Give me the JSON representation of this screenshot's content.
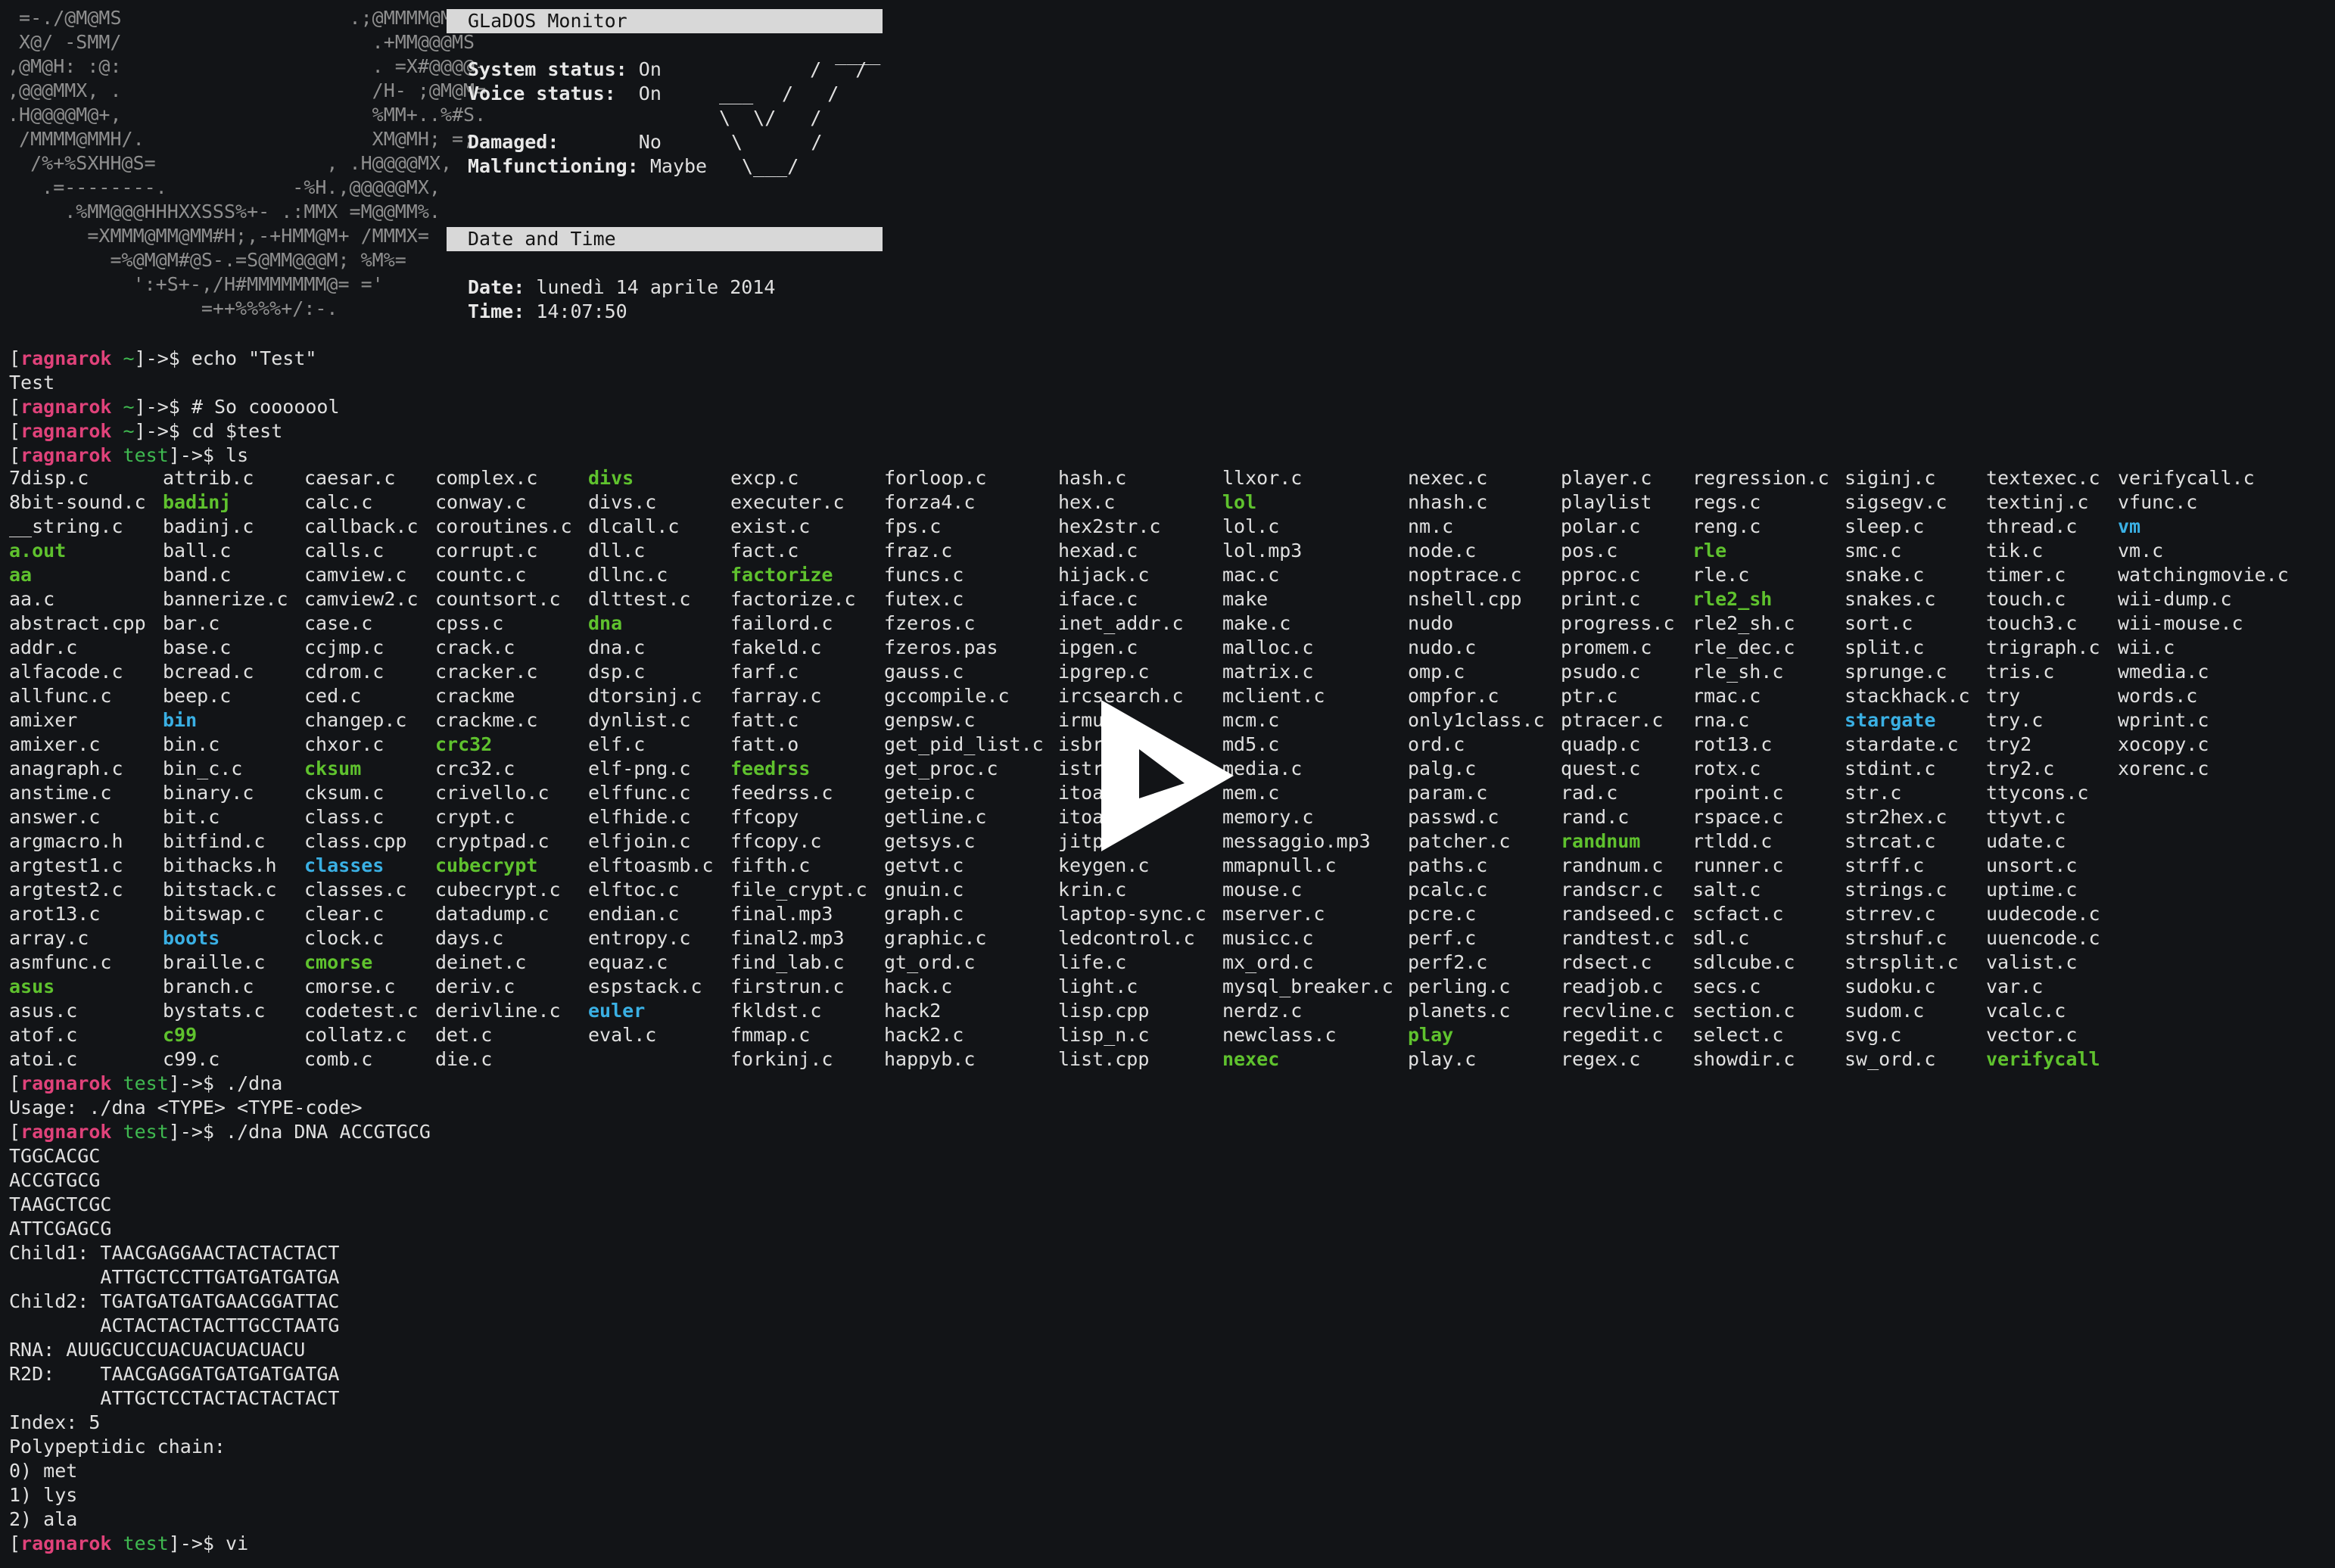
{
  "ascii_art": [
    " =-./@M@MS                    .;@MMMM@MM:",
    " X@/ -SMM/                      .+MM@@@MS",
    ",@M@H: :@:                      . =X#@@@@-",
    ",@@@MMX, .                      /H- ;@M@M=",
    ".H@@@@M@+,                      %MM+..%#S.",
    " /MMMM@MMH/.                    XM@MH; =;",
    "  /%+%SXHH@S=               , .H@@@@MX,",
    "   .=--------.           -%H.,@@@@@MX,",
    "     .%MM@@@HHHXXSSS%+- .:MMX =M@@MM%.",
    "       =XMMM@MM@MM#H;,-+HMM@M+ /MMMX=",
    "         =%@M@M#@S-.=S@MM@@@M; %M%=",
    "           ':+S+-,/H#MMMMMMM@= ='",
    "                 =++%%%%+/:-."
  ],
  "glados_panel": {
    "title": "GLaDOS Monitor",
    "system_status_label": "System status:",
    "system_status_value": "On",
    "voice_status_label": "Voice status:",
    "voice_status_value": "On",
    "damaged_label": "Damaged:",
    "damaged_value": "No",
    "malfunctioning_label": "Malfunctioning:",
    "malfunctioning_value": "Maybe",
    "logo_lines": [
      "   ____",
      "  /   /",
      " /   /",
      "/   /",
      "   /",
      "  /",
      "_/"
    ]
  },
  "datetime_panel": {
    "title": "Date and Time",
    "date_label": "Date:",
    "date_value": "lunedì 14 aprile 2014",
    "time_label": "Time:",
    "time_value": "14:07:50"
  },
  "prompt": {
    "user": "ragnarok",
    "open": "[",
    "close": "]->$ "
  },
  "session_top": [
    {
      "type": "prompt",
      "cwd": "~",
      "cmd": "echo \"Test\""
    },
    {
      "type": "out",
      "text": "Test"
    },
    {
      "type": "prompt",
      "cwd": "~",
      "cmd": "# So cooooool"
    },
    {
      "type": "prompt",
      "cwd": "~",
      "cmd": "cd $test"
    },
    {
      "type": "prompt",
      "cwd": "test",
      "cmd": "ls"
    }
  ],
  "ls_columns": [
    [
      "7disp.c",
      "8bit-sound.c",
      "__string.c",
      "a.out",
      "aa",
      "aa.c",
      "abstract.cpp",
      "addr.c",
      "alfacode.c",
      "allfunc.c",
      "amixer",
      "amixer.c",
      "anagraph.c",
      "anstime.c",
      "answer.c",
      "argmacro.h",
      "argtest1.c",
      "argtest2.c",
      "arot13.c",
      "array.c",
      "asmfunc.c",
      "asus",
      "asus.c",
      "atof.c",
      "atoi.c"
    ],
    [
      "attrib.c",
      "badinj",
      "badinj.c",
      "ball.c",
      "band.c",
      "bannerize.c",
      "bar.c",
      "base.c",
      "bcread.c",
      "beep.c",
      "bin",
      "bin.c",
      "bin_c.c",
      "binary.c",
      "bit.c",
      "bitfind.c",
      "bithacks.h",
      "bitstack.c",
      "bitswap.c",
      "boots",
      "braille.c",
      "branch.c",
      "bystats.c",
      "c99",
      "c99.c"
    ],
    [
      "caesar.c",
      "calc.c",
      "callback.c",
      "calls.c",
      "camview.c",
      "camview2.c",
      "case.c",
      "ccjmp.c",
      "cdrom.c",
      "ced.c",
      "changep.c",
      "chxor.c",
      "cksum",
      "cksum.c",
      "class.c",
      "class.cpp",
      "classes",
      "classes.c",
      "clear.c",
      "clock.c",
      "cmorse",
      "cmorse.c",
      "codetest.c",
      "collatz.c",
      "comb.c"
    ],
    [
      "complex.c",
      "conway.c",
      "coroutines.c",
      "corrupt.c",
      "countc.c",
      "countsort.c",
      "cpss.c",
      "crack.c",
      "cracker.c",
      "crackme",
      "crackme.c",
      "crc32",
      "crc32.c",
      "crivello.c",
      "crypt.c",
      "cryptpad.c",
      "cubecrypt",
      "cubecrypt.c",
      "datadump.c",
      "days.c",
      "deinet.c",
      "deriv.c",
      "derivline.c",
      "det.c",
      "die.c"
    ],
    [
      "divs",
      "divs.c",
      "dlcall.c",
      "dll.c",
      "dllnc.c",
      "dlttest.c",
      "dna",
      "dna.c",
      "dsp.c",
      "dtorsinj.c",
      "dynlist.c",
      "elf.c",
      "elf-png.c",
      "elffunc.c",
      "elfhide.c",
      "elfjoin.c",
      "elftoasmb.c",
      "elftoc.c",
      "endian.c",
      "entropy.c",
      "equaz.c",
      "espstack.c",
      "euler",
      "eval.c"
    ],
    [
      "excp.c",
      "executer.c",
      "exist.c",
      "fact.c",
      "factorize",
      "factorize.c",
      "failord.c",
      "fakeld.c",
      "farf.c",
      "farray.c",
      "fatt.c",
      "fatt.o",
      "feedrss",
      "feedrss.c",
      "ffcopy",
      "ffcopy.c",
      "fifth.c",
      "file_crypt.c",
      "final.mp3",
      "final2.mp3",
      "find_lab.c",
      "firstrun.c",
      "fkldst.c",
      "fmmap.c",
      "forkinj.c"
    ],
    [
      "forloop.c",
      "forza4.c",
      "fps.c",
      "fraz.c",
      "funcs.c",
      "futex.c",
      "fzeros.c",
      "fzeros.pas",
      "gauss.c",
      "gccompile.c",
      "genpsw.c",
      "get_pid_list.c",
      "get_proc.c",
      "geteip.c",
      "getline.c",
      "getsys.c",
      "getvt.c",
      "gnuin.c",
      "graph.c",
      "graphic.c",
      "gt_ord.c",
      "hack.c",
      "hack2",
      "hack2.c",
      "happyb.c"
    ],
    [
      "hash.c",
      "hex.c",
      "hex2str.c",
      "hexad.c",
      "hijack.c",
      "iface.c",
      "inet_addr.c",
      "ipgen.c",
      "ipgrep.c",
      "ircsearch.c",
      "irmu",
      "isbr",
      "istr",
      "itoa",
      "itoa",
      "jitp",
      "keygen.c",
      "krin.c",
      "laptop-sync.c",
      "ledcontrol.c",
      "life.c",
      "light.c",
      "lisp.cpp",
      "lisp_n.c",
      "list.cpp"
    ],
    [
      "llxor.c",
      "lol",
      "lol.c",
      "lol.mp3",
      "mac.c",
      "make",
      "make.c",
      "malloc.c",
      "matrix.c",
      "mclient.c",
      "mcm.c",
      "md5.c",
      "media.c",
      "mem.c",
      "memory.c",
      "messaggio.mp3",
      "mmapnull.c",
      "mouse.c",
      "mserver.c",
      "musicc.c",
      "mx_ord.c",
      "mysql_breaker.c",
      "nerdz.c",
      "newclass.c",
      "nexec"
    ],
    [
      "nexec.c",
      "nhash.c",
      "nm.c",
      "node.c",
      "noptrace.c",
      "nshell.cpp",
      "nudo",
      "nudo.c",
      "omp.c",
      "ompfor.c",
      "only1class.c",
      "ord.c",
      "palg.c",
      "param.c",
      "passwd.c",
      "patcher.c",
      "paths.c",
      "pcalc.c",
      "pcre.c",
      "perf.c",
      "perf2.c",
      "perling.c",
      "planets.c",
      "play",
      "play.c"
    ],
    [
      "player.c",
      "playlist",
      "polar.c",
      "pos.c",
      "pproc.c",
      "print.c",
      "progress.c",
      "promem.c",
      "psudo.c",
      "ptr.c",
      "ptracer.c",
      "quadp.c",
      "quest.c",
      "rad.c",
      "rand.c",
      "randnum",
      "randnum.c",
      "randscr.c",
      "randseed.c",
      "randtest.c",
      "rdsect.c",
      "readjob.c",
      "recvline.c",
      "regedit.c",
      "regex.c"
    ],
    [
      "regression.c",
      "regs.c",
      "reng.c",
      "rle",
      "rle.c",
      "rle2_sh",
      "rle2_sh.c",
      "rle_dec.c",
      "rle_sh.c",
      "rmac.c",
      "rna.c",
      "rot13.c",
      "rotx.c",
      "rpoint.c",
      "rspace.c",
      "rtldd.c",
      "runner.c",
      "salt.c",
      "scfact.c",
      "sdl.c",
      "sdlcube.c",
      "secs.c",
      "section.c",
      "select.c",
      "showdir.c"
    ],
    [
      "siginj.c",
      "sigsegv.c",
      "sleep.c",
      "smc.c",
      "snake.c",
      "snakes.c",
      "sort.c",
      "split.c",
      "sprunge.c",
      "stackhack.c",
      "stargate",
      "stardate.c",
      "stdint.c",
      "str.c",
      "str2hex.c",
      "strcat.c",
      "strff.c",
      "strings.c",
      "strrev.c",
      "strshuf.c",
      "strsplit.c",
      "sudoku.c",
      "sudom.c",
      "svg.c",
      "sw_ord.c"
    ],
    [
      "textexec.c",
      "textinj.c",
      "thread.c",
      "tik.c",
      "timer.c",
      "touch.c",
      "touch3.c",
      "trigraph.c",
      "tris.c",
      "try",
      "try.c",
      "try2",
      "try2.c",
      "ttycons.c",
      "ttyvt.c",
      "udate.c",
      "unsort.c",
      "uptime.c",
      "uudecode.c",
      "uuencode.c",
      "valist.c",
      "var.c",
      "vcalc.c",
      "vector.c",
      "verifycall"
    ],
    [
      "verifycall.c",
      "vfunc.c",
      "vm",
      "vm.c",
      "watchingmovie.c",
      "wii-dump.c",
      "wii-mouse.c",
      "wii.c",
      "wmedia.c",
      "words.c",
      "wprint.c",
      "xocopy.c",
      "xorenc.c"
    ]
  ],
  "ls_executables": [
    "a.out",
    "aa",
    "asus",
    "badinj",
    "c99",
    "cksum",
    "cmorse",
    "crc32",
    "cubecrypt",
    "divs",
    "dna",
    "factorize",
    "feedrss",
    "lol",
    "nexec",
    "play",
    "randnum",
    "rle",
    "rle2_sh",
    "verifycall"
  ],
  "ls_directories": [
    "bin",
    "boots",
    "classes",
    "euler",
    "stargate",
    "vm"
  ],
  "session_bottom": [
    {
      "type": "prompt",
      "cwd": "test",
      "cmd": "./dna"
    },
    {
      "type": "out",
      "text": "Usage: ./dna <TYPE> <TYPE-code>"
    },
    {
      "type": "prompt",
      "cwd": "test",
      "cmd": "./dna DNA ACCGTGCG"
    },
    {
      "type": "out",
      "text": "TGGCACGC"
    },
    {
      "type": "out",
      "text": "ACCGTGCG"
    },
    {
      "type": "out",
      "text": "TAAGCTCGC"
    },
    {
      "type": "out",
      "text": "ATTCGAGCG"
    },
    {
      "type": "out",
      "text": "Child1: TAACGAGGAACTACTACTACT"
    },
    {
      "type": "out",
      "text": "        ATTGCTCCTTGATGATGATGA"
    },
    {
      "type": "out",
      "text": "Child2: TGATGATGATGAACGGATTAC"
    },
    {
      "type": "out",
      "text": "        ACTACTACTACTTGCCTAATG"
    },
    {
      "type": "out",
      "text": "RNA: AUUGCUCCUACUACUACUACU"
    },
    {
      "type": "out",
      "text": "R2D:    TAACGAGGATGATGATGATGA"
    },
    {
      "type": "out",
      "text": "        ATTGCTCCTACTACTACTACT"
    },
    {
      "type": "out",
      "text": "Index: 5"
    },
    {
      "type": "out",
      "text": "Polypeptidic chain:"
    },
    {
      "type": "out",
      "text": "0) met"
    },
    {
      "type": "out",
      "text": "1) lys"
    },
    {
      "type": "out",
      "text": "2) ala"
    },
    {
      "type": "prompt",
      "cwd": "test",
      "cmd": "vi"
    }
  ],
  "colors": {
    "background": "#121417",
    "text": "#e0e0e0",
    "user": "#e0427a",
    "cwd": "#3fb950",
    "executable": "#5fc22e",
    "directory": "#3ab0e4",
    "panel_header_bg": "#d8d8d8"
  },
  "overlay": {
    "icon": "play-icon"
  }
}
